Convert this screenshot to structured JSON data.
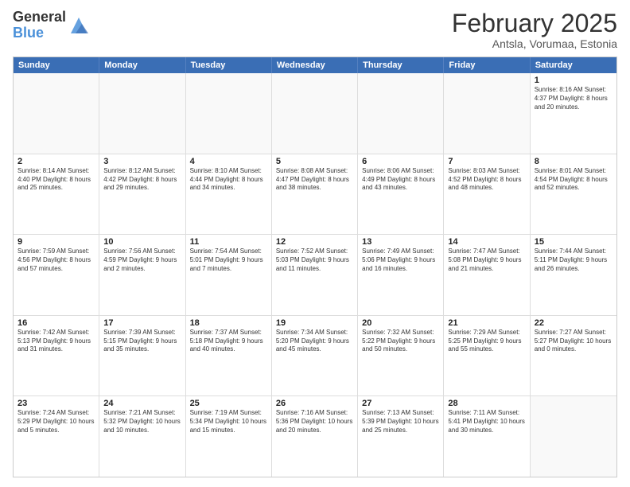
{
  "logo": {
    "general": "General",
    "blue": "Blue"
  },
  "title": "February 2025",
  "subtitle": "Antsla, Vorumaa, Estonia",
  "header_days": [
    "Sunday",
    "Monday",
    "Tuesday",
    "Wednesday",
    "Thursday",
    "Friday",
    "Saturday"
  ],
  "weeks": [
    [
      {
        "day": "",
        "info": ""
      },
      {
        "day": "",
        "info": ""
      },
      {
        "day": "",
        "info": ""
      },
      {
        "day": "",
        "info": ""
      },
      {
        "day": "",
        "info": ""
      },
      {
        "day": "",
        "info": ""
      },
      {
        "day": "1",
        "info": "Sunrise: 8:16 AM\nSunset: 4:37 PM\nDaylight: 8 hours and 20 minutes."
      }
    ],
    [
      {
        "day": "2",
        "info": "Sunrise: 8:14 AM\nSunset: 4:40 PM\nDaylight: 8 hours and 25 minutes."
      },
      {
        "day": "3",
        "info": "Sunrise: 8:12 AM\nSunset: 4:42 PM\nDaylight: 8 hours and 29 minutes."
      },
      {
        "day": "4",
        "info": "Sunrise: 8:10 AM\nSunset: 4:44 PM\nDaylight: 8 hours and 34 minutes."
      },
      {
        "day": "5",
        "info": "Sunrise: 8:08 AM\nSunset: 4:47 PM\nDaylight: 8 hours and 38 minutes."
      },
      {
        "day": "6",
        "info": "Sunrise: 8:06 AM\nSunset: 4:49 PM\nDaylight: 8 hours and 43 minutes."
      },
      {
        "day": "7",
        "info": "Sunrise: 8:03 AM\nSunset: 4:52 PM\nDaylight: 8 hours and 48 minutes."
      },
      {
        "day": "8",
        "info": "Sunrise: 8:01 AM\nSunset: 4:54 PM\nDaylight: 8 hours and 52 minutes."
      }
    ],
    [
      {
        "day": "9",
        "info": "Sunrise: 7:59 AM\nSunset: 4:56 PM\nDaylight: 8 hours and 57 minutes."
      },
      {
        "day": "10",
        "info": "Sunrise: 7:56 AM\nSunset: 4:59 PM\nDaylight: 9 hours and 2 minutes."
      },
      {
        "day": "11",
        "info": "Sunrise: 7:54 AM\nSunset: 5:01 PM\nDaylight: 9 hours and 7 minutes."
      },
      {
        "day": "12",
        "info": "Sunrise: 7:52 AM\nSunset: 5:03 PM\nDaylight: 9 hours and 11 minutes."
      },
      {
        "day": "13",
        "info": "Sunrise: 7:49 AM\nSunset: 5:06 PM\nDaylight: 9 hours and 16 minutes."
      },
      {
        "day": "14",
        "info": "Sunrise: 7:47 AM\nSunset: 5:08 PM\nDaylight: 9 hours and 21 minutes."
      },
      {
        "day": "15",
        "info": "Sunrise: 7:44 AM\nSunset: 5:11 PM\nDaylight: 9 hours and 26 minutes."
      }
    ],
    [
      {
        "day": "16",
        "info": "Sunrise: 7:42 AM\nSunset: 5:13 PM\nDaylight: 9 hours and 31 minutes."
      },
      {
        "day": "17",
        "info": "Sunrise: 7:39 AM\nSunset: 5:15 PM\nDaylight: 9 hours and 35 minutes."
      },
      {
        "day": "18",
        "info": "Sunrise: 7:37 AM\nSunset: 5:18 PM\nDaylight: 9 hours and 40 minutes."
      },
      {
        "day": "19",
        "info": "Sunrise: 7:34 AM\nSunset: 5:20 PM\nDaylight: 9 hours and 45 minutes."
      },
      {
        "day": "20",
        "info": "Sunrise: 7:32 AM\nSunset: 5:22 PM\nDaylight: 9 hours and 50 minutes."
      },
      {
        "day": "21",
        "info": "Sunrise: 7:29 AM\nSunset: 5:25 PM\nDaylight: 9 hours and 55 minutes."
      },
      {
        "day": "22",
        "info": "Sunrise: 7:27 AM\nSunset: 5:27 PM\nDaylight: 10 hours and 0 minutes."
      }
    ],
    [
      {
        "day": "23",
        "info": "Sunrise: 7:24 AM\nSunset: 5:29 PM\nDaylight: 10 hours and 5 minutes."
      },
      {
        "day": "24",
        "info": "Sunrise: 7:21 AM\nSunset: 5:32 PM\nDaylight: 10 hours and 10 minutes."
      },
      {
        "day": "25",
        "info": "Sunrise: 7:19 AM\nSunset: 5:34 PM\nDaylight: 10 hours and 15 minutes."
      },
      {
        "day": "26",
        "info": "Sunrise: 7:16 AM\nSunset: 5:36 PM\nDaylight: 10 hours and 20 minutes."
      },
      {
        "day": "27",
        "info": "Sunrise: 7:13 AM\nSunset: 5:39 PM\nDaylight: 10 hours and 25 minutes."
      },
      {
        "day": "28",
        "info": "Sunrise: 7:11 AM\nSunset: 5:41 PM\nDaylight: 10 hours and 30 minutes."
      },
      {
        "day": "",
        "info": ""
      }
    ]
  ]
}
